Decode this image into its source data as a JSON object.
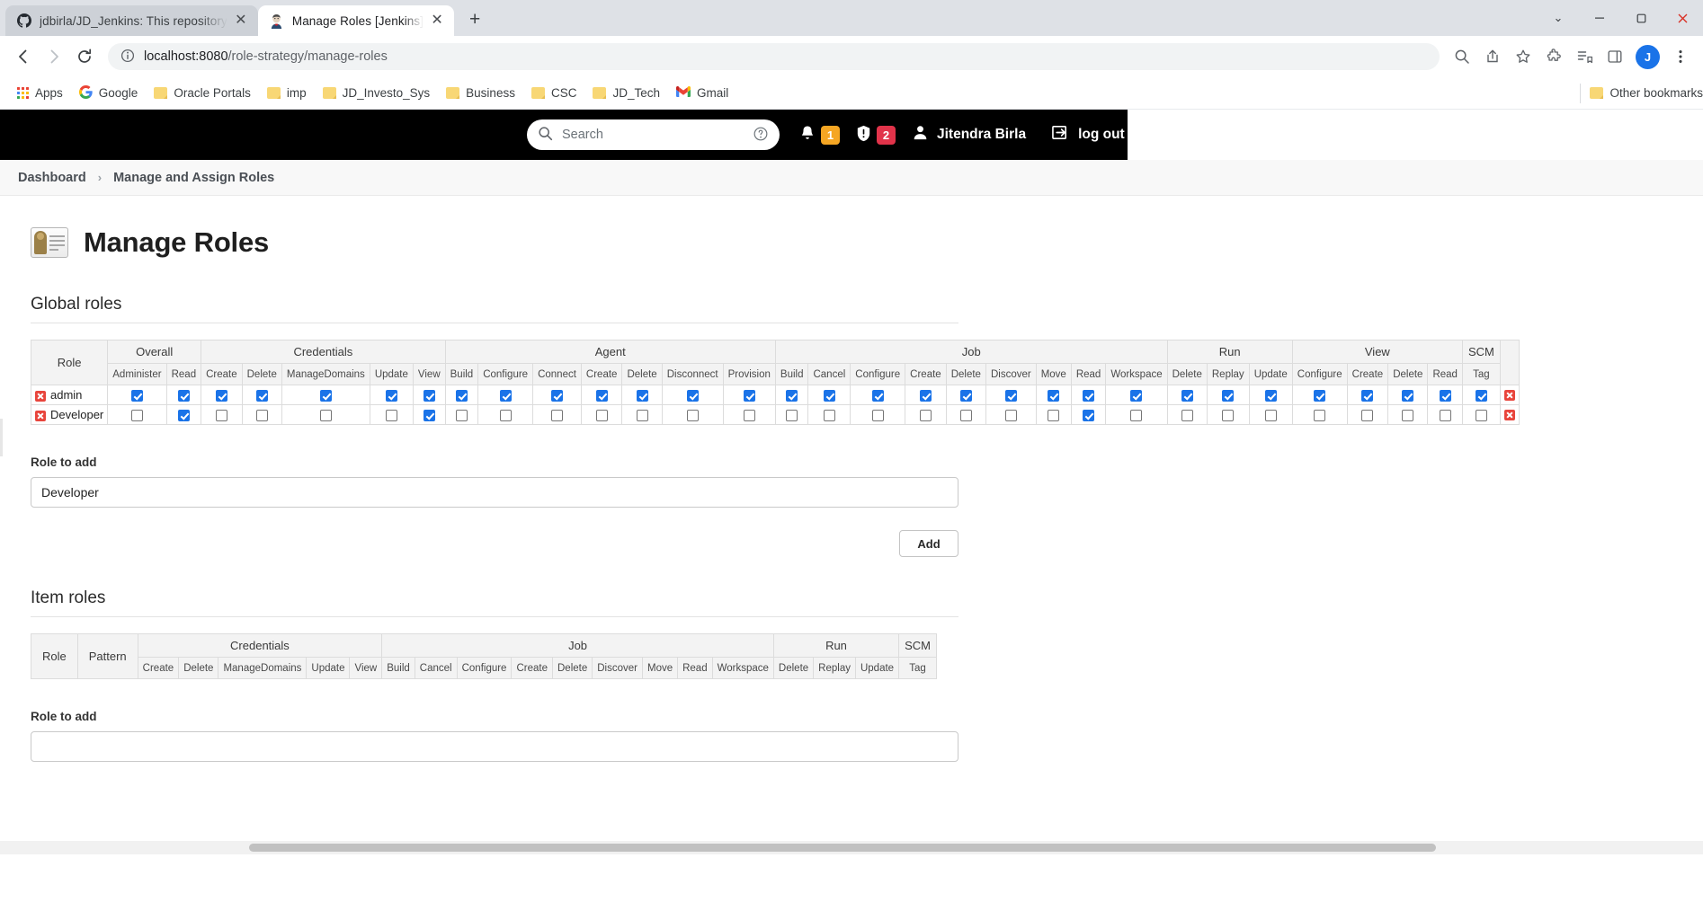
{
  "browser": {
    "tabs": [
      {
        "title": "jdbirla/JD_Jenkins: This repository",
        "favicon": "github-icon",
        "active": false,
        "close_label": "✕"
      },
      {
        "title": "Manage Roles [Jenkins]",
        "favicon": "jenkins-icon",
        "active": true,
        "close_label": "✕"
      }
    ],
    "new_tab_label": "+",
    "window_controls": {
      "minimize": "–",
      "maximize": "❐",
      "close": "✕",
      "more": "⌄"
    },
    "nav": {
      "back": "←",
      "forward": "→",
      "reload": "⟳"
    },
    "omnibox": {
      "info_icon": "site-info-icon",
      "host": "localhost:8080",
      "path": "/role-strategy/manage-roles",
      "full_url": "localhost:8080/role-strategy/manage-roles"
    },
    "toolbar_icons": [
      "zoom-search-icon",
      "share-icon",
      "bookmark-star-icon",
      "extensions-puzzle-icon",
      "reading-list-icon",
      "sidepanel-icon"
    ],
    "profile_initial": "J",
    "menu_icon": "three-dot-menu-icon",
    "bookmarks": [
      {
        "label": "Apps",
        "icon": "apps-grid-icon"
      },
      {
        "label": "Google",
        "icon": "google-icon"
      },
      {
        "label": "Oracle Portals",
        "icon": "folder-icon"
      },
      {
        "label": "imp",
        "icon": "folder-icon"
      },
      {
        "label": "JD_Investo_Sys",
        "icon": "folder-icon"
      },
      {
        "label": "Business",
        "icon": "folder-icon"
      },
      {
        "label": "CSC",
        "icon": "folder-icon"
      },
      {
        "label": "JD_Tech",
        "icon": "folder-icon"
      },
      {
        "label": "Gmail",
        "icon": "gmail-icon"
      }
    ],
    "other_bookmarks": {
      "label": "Other bookmarks",
      "icon": "folder-icon"
    }
  },
  "jenkins": {
    "header": {
      "search_placeholder": "Search",
      "search_value": "",
      "search_icon": "search-icon",
      "help_icon": "help-circle-icon",
      "notifications": {
        "icon": "bell-icon",
        "count": "1",
        "color": "#f5a623"
      },
      "security": {
        "icon": "shield-alert-icon",
        "count": "2",
        "color": "#e1334a"
      },
      "user": {
        "name": "Jitendra Birla",
        "icon": "person-icon"
      },
      "logout": {
        "label": "log out",
        "icon": "logout-arrow-icon"
      }
    },
    "breadcrumb": {
      "root": "Dashboard",
      "separator": "›",
      "current": "Manage and Assign Roles"
    },
    "page_title": "Manage Roles",
    "page_title_icon": "id-card-icon",
    "global_roles": {
      "section_title": "Global roles",
      "role_column_label": "Role",
      "groups": [
        {
          "label": "Overall",
          "permissions": [
            "Administer",
            "Read"
          ]
        },
        {
          "label": "Credentials",
          "permissions": [
            "Create",
            "Delete",
            "ManageDomains",
            "Update",
            "View"
          ]
        },
        {
          "label": "Agent",
          "permissions": [
            "Build",
            "Configure",
            "Connect",
            "Create",
            "Delete",
            "Disconnect",
            "Provision"
          ]
        },
        {
          "label": "Job",
          "permissions": [
            "Build",
            "Cancel",
            "Configure",
            "Create",
            "Delete",
            "Discover",
            "Move",
            "Read",
            "Workspace"
          ]
        },
        {
          "label": "Run",
          "permissions": [
            "Delete",
            "Replay",
            "Update"
          ]
        },
        {
          "label": "View",
          "permissions": [
            "Configure",
            "Create",
            "Delete",
            "Read"
          ]
        },
        {
          "label": "SCM",
          "permissions": [
            "Tag"
          ]
        }
      ],
      "rows": [
        {
          "name": "admin",
          "delete_icon": "delete-role-icon",
          "checked": [
            true,
            true,
            true,
            true,
            true,
            true,
            true,
            true,
            true,
            true,
            true,
            true,
            true,
            true,
            true,
            true,
            true,
            true,
            true,
            true,
            true,
            true,
            true,
            true,
            true,
            true,
            true,
            true,
            true,
            true,
            true
          ]
        },
        {
          "name": "Developer",
          "delete_icon": "delete-role-icon",
          "checked": [
            false,
            true,
            false,
            false,
            false,
            false,
            true,
            false,
            false,
            false,
            false,
            false,
            false,
            false,
            false,
            false,
            false,
            false,
            false,
            false,
            false,
            true,
            false,
            false,
            false,
            false,
            false,
            false,
            false,
            false,
            false
          ]
        }
      ],
      "role_to_add": {
        "label": "Role to add",
        "value": "Developer",
        "placeholder": ""
      },
      "add_button": "Add"
    },
    "item_roles": {
      "section_title": "Item roles",
      "role_column_label": "Role",
      "pattern_column_label": "Pattern",
      "groups": [
        {
          "label": "Credentials",
          "permissions": [
            "Create",
            "Delete",
            "ManageDomains",
            "Update",
            "View"
          ]
        },
        {
          "label": "Job",
          "permissions": [
            "Build",
            "Cancel",
            "Configure",
            "Create",
            "Delete",
            "Discover",
            "Move",
            "Read",
            "Workspace"
          ]
        },
        {
          "label": "Run",
          "permissions": [
            "Delete",
            "Replay",
            "Update"
          ]
        },
        {
          "label": "SCM",
          "permissions": [
            "Tag"
          ]
        }
      ],
      "rows": [],
      "role_to_add": {
        "label": "Role to add",
        "value": "",
        "placeholder": ""
      }
    }
  }
}
